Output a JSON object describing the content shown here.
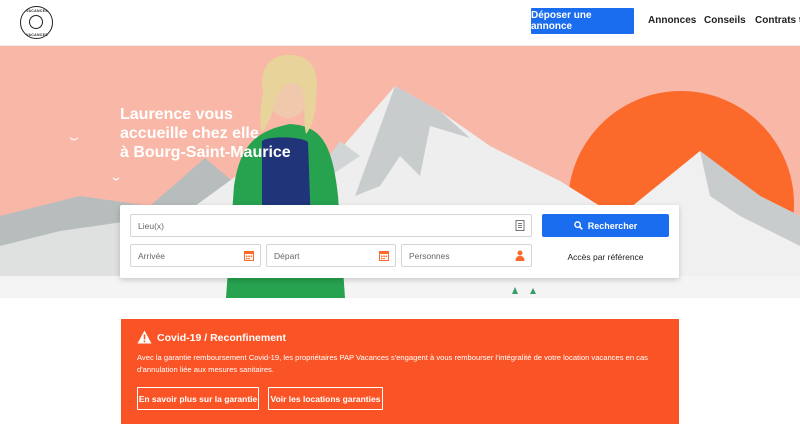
{
  "header": {
    "logo_top": "VACANCES",
    "logo_bottom": "VACANCES",
    "cta_label": "Déposer une annonce",
    "nav": [
      "Annonces",
      "Conseils",
      "Contrats ty"
    ]
  },
  "hero": {
    "title_line1": "Laurence vous",
    "title_line2": "accueille chez elle",
    "title_line3": "à Bourg-Saint-Maurice"
  },
  "search": {
    "location_placeholder": "Lieu(x)",
    "arrival_placeholder": "Arrivée",
    "departure_placeholder": "Départ",
    "persons_placeholder": "Personnes",
    "search_button": "Rechercher",
    "reference_link": "Accès par référence"
  },
  "covid": {
    "title": "Covid-19 / Reconfinement",
    "text": "Avec la garantie remboursement Covid-19, les propriétaires PAP Vacances s'engagent à vous rembourser l'intégralité de votre location vacances en cas d'annulation liée aux mesures sanitaires.",
    "button_guarantee": "En savoir plus sur la garantie",
    "button_rentals": "Voir les locations garanties"
  },
  "colors": {
    "primary_blue": "#1a6dee",
    "hero_pink": "#f8b7a7",
    "sun_orange": "#fb6a2a",
    "covid_orange": "#fa5426"
  }
}
